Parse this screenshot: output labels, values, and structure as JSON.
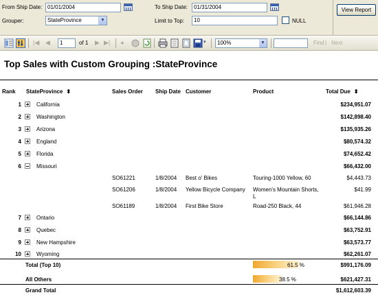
{
  "params": {
    "from_ship_date_label": "From Ship Date:",
    "from_ship_date_value": "01/01/2004",
    "to_ship_date_label": "To Ship Date:",
    "to_ship_date_value": "01/31/2004",
    "grouper_label": "Grouper:",
    "grouper_value": "StateProvince",
    "limit_label": "Limit to Top:",
    "limit_value": "10",
    "null_label": "NULL",
    "view_report_label": "View Report"
  },
  "toolbar": {
    "page_value": "1",
    "of_label": "of 1",
    "zoom_value": "100%",
    "find_label": "Find",
    "divider": "|",
    "next_label": "Next"
  },
  "report": {
    "title": "Top Sales with Custom Grouping :StateProvince",
    "headers": {
      "rank": "Rank",
      "stateprovince": "StateProvince",
      "sales_order": "Sales Order",
      "ship_date": "Ship Date",
      "customer": "Customer",
      "product": "Product",
      "total_due": "Total Due"
    },
    "sort_glyph": "⬍",
    "groups": [
      {
        "rank": "1",
        "name": "California",
        "total": "$234,951.07"
      },
      {
        "rank": "2",
        "name": "Washington",
        "total": "$142,898.40"
      },
      {
        "rank": "3",
        "name": "Arizona",
        "total": "$135,935.26"
      },
      {
        "rank": "4",
        "name": "England",
        "total": "$80,574.32"
      },
      {
        "rank": "5",
        "name": "Florida",
        "total": "$74,652.42"
      },
      {
        "rank": "6",
        "name": "Missouri",
        "total": "$66,432.00"
      },
      {
        "rank": "7",
        "name": "Ontario",
        "total": "$66,144.86"
      },
      {
        "rank": "8",
        "name": "Quebec",
        "total": "$63,752.91"
      },
      {
        "rank": "9",
        "name": "New Hampshire",
        "total": "$63,573.77"
      },
      {
        "rank": "10",
        "name": "Wyoming",
        "total": "$62,261.07"
      }
    ],
    "details": [
      {
        "order": "SO61221",
        "date": "1/8/2004",
        "customer": "Best o' Bikes",
        "product": "Touring-1000 Yellow, 60",
        "total": "$4,443.73"
      },
      {
        "order": "SO61206",
        "date": "1/8/2004",
        "customer": "Yellow Bicycle Company",
        "product_line1": "Women's Mountain Shorts,",
        "product_line2": "L",
        "total": "$41.99"
      },
      {
        "order": "SO61189",
        "date": "1/8/2004",
        "customer": "First Bike Store",
        "product": "Road-250 Black, 44",
        "total": "$61,946.28"
      }
    ],
    "summary": {
      "top_label": "Total (Top 10)",
      "top_pct": "61.5 %",
      "top_pct_value": 61.5,
      "top_total": "$991,176.09",
      "others_label": "All Others",
      "others_pct": "38.5 %",
      "others_pct_value": 38.5,
      "others_total": "$621,427.31",
      "grand_label": "Grand Total",
      "grand_total": "$1,612,603.39"
    }
  },
  "colors": {
    "bar": "#f0a830",
    "params_bg": "#ece9d8"
  }
}
